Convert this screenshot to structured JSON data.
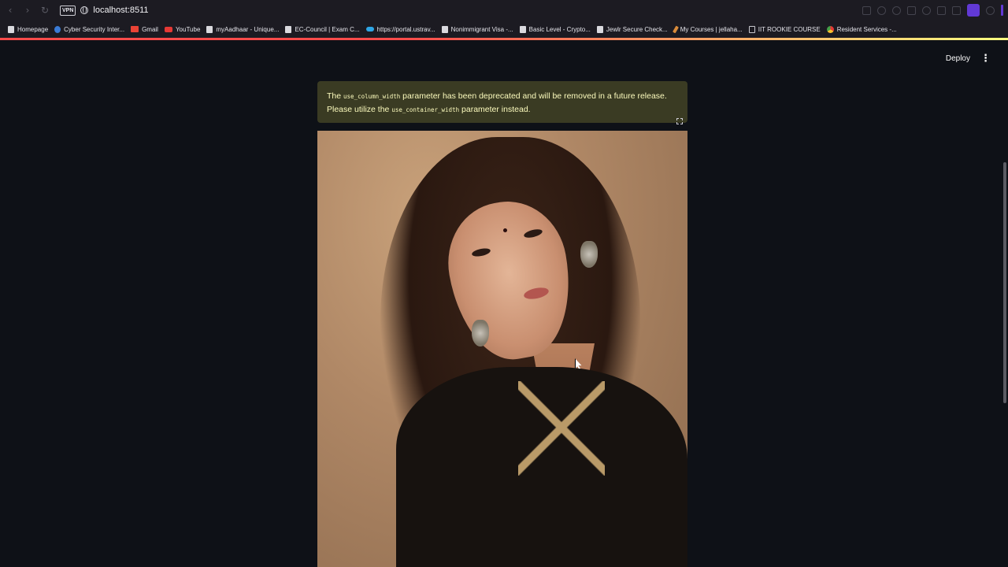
{
  "browser": {
    "vpn_label": "VPN",
    "url": "localhost:8511",
    "nav": {
      "back_icon": "chevron-left-icon",
      "forward_icon": "chevron-right-icon",
      "reload_icon": "reload-icon"
    },
    "accent": "#6d3ef5"
  },
  "bookmarks": [
    {
      "label": "Homepage",
      "icon": "page-icon"
    },
    {
      "label": "Cyber Security Inter...",
      "icon": "blue-logo-icon"
    },
    {
      "label": "Gmail",
      "icon": "gmail-icon"
    },
    {
      "label": "YouTube",
      "icon": "youtube-icon"
    },
    {
      "label": "myAadhaar - Unique...",
      "icon": "page-icon"
    },
    {
      "label": "EC-Council | Exam C...",
      "icon": "page-icon"
    },
    {
      "label": "https://portal.ustrav...",
      "icon": "cloud-icon"
    },
    {
      "label": "Nonimmigrant Visa -...",
      "icon": "page-icon"
    },
    {
      "label": "Basic Level - Crypto...",
      "icon": "page-icon"
    },
    {
      "label": "Jewlr Secure Check...",
      "icon": "page-icon"
    },
    {
      "label": "My Courses | jellaha...",
      "icon": "pen-icon"
    },
    {
      "label": "IIT ROOKIE COURSE",
      "icon": "folder-icon"
    },
    {
      "label": "Resident Services -...",
      "icon": "multicolor-icon"
    }
  ],
  "app": {
    "deploy_label": "Deploy",
    "menu_icon": "kebab-menu-icon"
  },
  "alert": {
    "text_1": "The ",
    "code_1": "use_column_width",
    "text_2": " parameter has been deprecated and will be removed in a future release. Please utilize the ",
    "code_2": "use_container_width",
    "text_3": " parameter instead.",
    "background": "#3a3b23",
    "text_color": "#fcfbbd"
  },
  "image": {
    "alt": "Portrait photo"
  }
}
